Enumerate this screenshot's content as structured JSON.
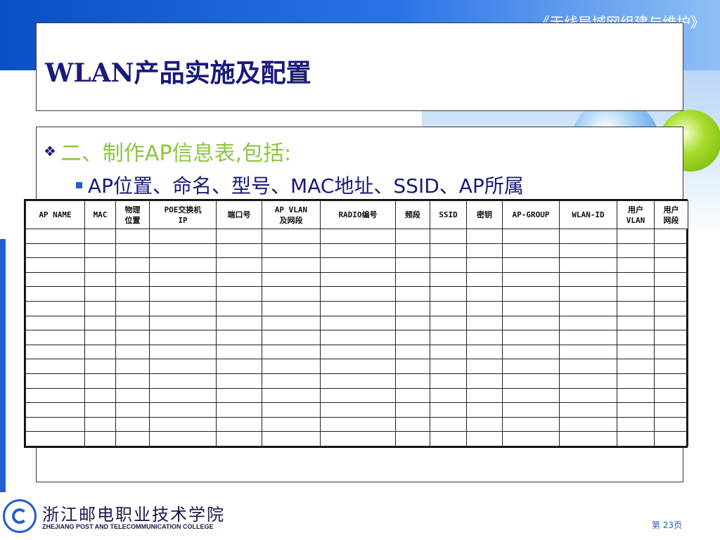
{
  "header": {
    "course_title": "《无线局域网组建与维护》"
  },
  "slide": {
    "title": "WLAN产品实施及配置",
    "bullet": "二、制作AP信息表,包括:",
    "sub_bullet": "AP位置、命名、型号、MAC地址、SSID、AP所属"
  },
  "table": {
    "headers": [
      "AP NAME",
      "MAC",
      "物理\n位置",
      "POE交换机\nIP",
      "端口号",
      "AP VLAN\n及网段",
      "RADIO编号",
      "频段",
      "SSID",
      "密钥",
      "AP-GROUP",
      "WLAN-ID",
      "用户\nVLAN",
      "用户\n网段"
    ],
    "empty_row_count": 15
  },
  "footer": {
    "college_cn": "浙江邮电职业技术学院",
    "college_en": "ZHEJIANG POST AND TELECOMMUNICATION COLLEGE",
    "page_label": "第 23页"
  },
  "colors": {
    "title": "#1a1a7a",
    "bullet": "#8cc63f",
    "accent": "#1f5fd1"
  }
}
